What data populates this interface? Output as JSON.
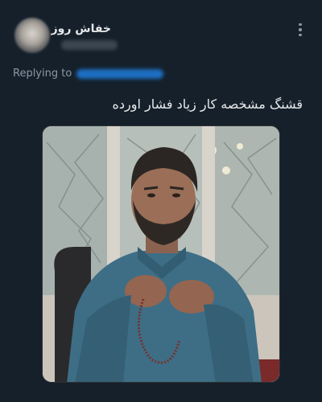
{
  "tweet": {
    "display_name": "خفاش روز",
    "replying_label": "Replying to",
    "text": "قشنگ مشخصه کار زیاد فشار اورده"
  },
  "icons": {
    "more": "more-vertical-icon"
  },
  "colors": {
    "background": "#15202b",
    "primary_text": "#e7e9ea",
    "secondary_text": "#8b98a5",
    "link": "#1d9bf0"
  }
}
